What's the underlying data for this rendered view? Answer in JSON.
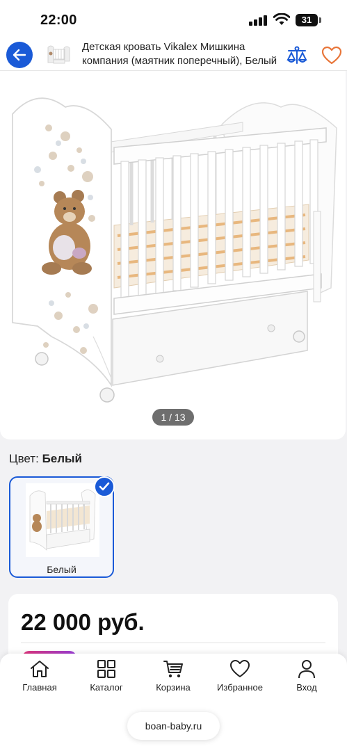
{
  "status_bar": {
    "time": "22:00",
    "battery": "31"
  },
  "header": {
    "title": "Детская кровать Vikalex Мишкина компания (маятник поперечный), Белый",
    "back_icon": "arrow-left-icon",
    "compare_icon": "scales-icon",
    "favorite_icon": "heart-icon"
  },
  "gallery": {
    "counter": "1 / 13"
  },
  "color_selector": {
    "label": "Цвет:",
    "value": "Белый",
    "options": [
      {
        "label": "Белый",
        "selected": true
      }
    ]
  },
  "price": {
    "value": "22 000 руб."
  },
  "bottom_nav": {
    "items": [
      {
        "label": "Главная",
        "icon": "home-icon"
      },
      {
        "label": "Каталог",
        "icon": "grid-icon"
      },
      {
        "label": "Корзина",
        "icon": "cart-icon"
      },
      {
        "label": "Избранное",
        "icon": "heart-icon"
      },
      {
        "label": "Вход",
        "icon": "user-icon"
      }
    ]
  },
  "browser": {
    "url": "boan-baby.ru"
  },
  "colors": {
    "accent": "#1a5ad7",
    "favorite": "#e8763a"
  }
}
